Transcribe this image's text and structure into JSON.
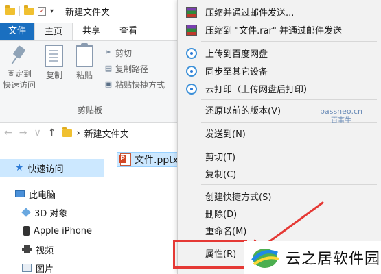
{
  "window": {
    "title": "新建文件夹",
    "check_glyph": "✓",
    "caret_glyph": "▾"
  },
  "ribbon": {
    "tabs": [
      {
        "label": "文件"
      },
      {
        "label": "主页"
      },
      {
        "label": "共享"
      },
      {
        "label": "查看"
      }
    ],
    "pin_label_1": "固定到",
    "pin_label_2": "快速访问",
    "copy_label": "复制",
    "paste_label": "粘贴",
    "cut_label": "剪切",
    "copy_path_label": "复制路径",
    "paste_shortcut_label": "粘贴快捷方式",
    "group_label": "剪贴板"
  },
  "address": {
    "back": "←",
    "forward": "→",
    "dropdown": "∨",
    "up": "↑",
    "chevron": "›",
    "path": "新建文件夹"
  },
  "nav": {
    "quick_access": "快速访问",
    "this_pc": "此电脑",
    "objects_3d": "3D 对象",
    "iphone": "Apple iPhone",
    "videos": "视频",
    "pictures": "图片"
  },
  "file": {
    "name": "文件.pptx"
  },
  "context_menu": {
    "compress_email": "压缩并通过邮件发送...",
    "compress_rar_email": "压缩到 \"文件.rar\" 并通过邮件发送",
    "upload_baidu": "上传到百度网盘",
    "sync_devices": "同步至其它设备",
    "cloud_print": "云打印（上传网盘后打印）",
    "restore_versions": "还原以前的版本(V)",
    "send_to": "发送到(N)",
    "cut": "剪切(T)",
    "copy": "复制(C)",
    "create_shortcut": "创建快捷方式(S)",
    "delete": "删除(D)",
    "rename": "重命名(M)",
    "properties": "属性(R)"
  },
  "watermark": {
    "line1": "passneo.cn",
    "line2": "百事牛"
  },
  "brand": {
    "text": "云之居软件园"
  },
  "colors": {
    "file_tab": "#1a6fc0",
    "selection": "#cce8ff",
    "highlight_box": "#e53935",
    "menu_bg": "#f2f2f2"
  }
}
